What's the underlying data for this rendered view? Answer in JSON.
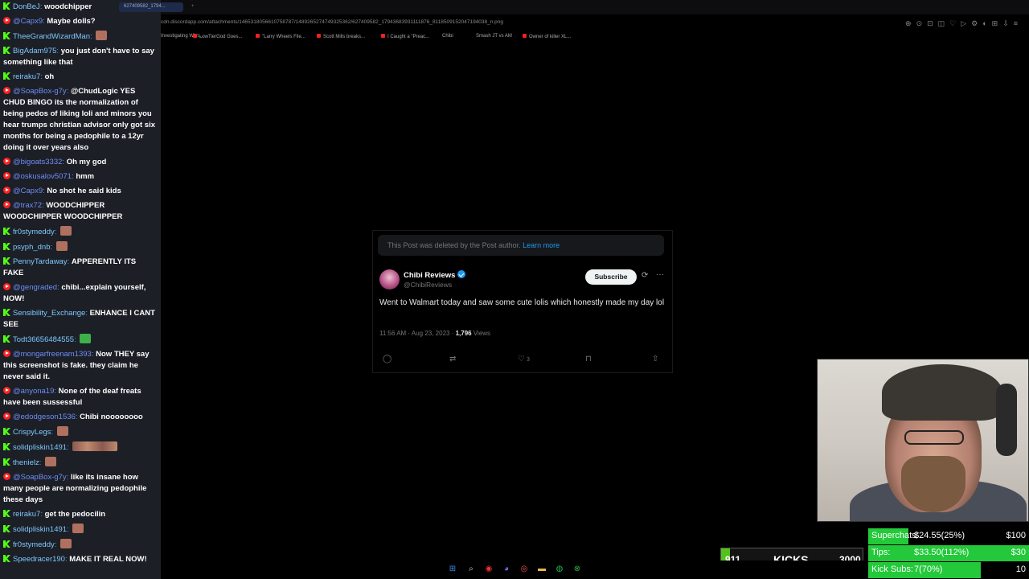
{
  "chat": {
    "messages": [
      {
        "platform": "kick",
        "user": "DonBeJ",
        "text": "woodchipper"
      },
      {
        "platform": "yt",
        "user": "@Capx9",
        "text": "Maybe dolls?"
      },
      {
        "platform": "kick",
        "user": "TheeGrandWizardMan",
        "text": "",
        "emote": "single"
      },
      {
        "platform": "kick",
        "user": "BigAdam975",
        "text": "you just don't have to say something like that"
      },
      {
        "platform": "kick",
        "user": "reiraku7",
        "text": "oh"
      },
      {
        "platform": "yt",
        "user": "@SoapBox-g7y",
        "text": "@ChudLogic YES CHUD BINGO its the normalization of being pedos of liking loli and minors you hear trumps christian advisor only got six months for being a pedophile to a 12yr doing it over years also"
      },
      {
        "platform": "yt",
        "user": "@bigoats3332",
        "text": "Oh my god"
      },
      {
        "platform": "yt",
        "user": "@oskusalov5071",
        "text": "hmm"
      },
      {
        "platform": "yt",
        "user": "@Capx9",
        "text": "No shot he said kids"
      },
      {
        "platform": "yt",
        "user": "@trax72",
        "text": "WOODCHIPPER WOODCHIPPER WOODCHIPPER"
      },
      {
        "platform": "kick",
        "user": "fr0stymeddy",
        "text": "",
        "emote": "single"
      },
      {
        "platform": "kick",
        "user": "psyph_dnb",
        "text": "",
        "emote": "single"
      },
      {
        "platform": "kick",
        "user": "PennyTardaway",
        "text": "APPERENTLY ITS FAKE"
      },
      {
        "platform": "yt",
        "user": "@gengraded",
        "text": "chibi...explain yourself, NOW!"
      },
      {
        "platform": "kick",
        "user": "Sensibility_Exchange",
        "text": "ENHANCE I CANT SEE"
      },
      {
        "platform": "kick",
        "user": "Todt36656484555",
        "text": "",
        "emote": "green"
      },
      {
        "platform": "yt",
        "user": "@mongarfreenam1393",
        "text": "Now THEY say this screenshot is fake. they claim he never said it."
      },
      {
        "platform": "yt",
        "user": "@anyona19",
        "text": "None of the deaf freats have been sussessful"
      },
      {
        "platform": "yt",
        "user": "@edodgeson1536",
        "text": "Chibi noooooooo"
      },
      {
        "platform": "kick",
        "user": "CrispyLegs",
        "text": "",
        "emote": "single"
      },
      {
        "platform": "kick",
        "user": "solidpliskin1491",
        "text": "",
        "emote": "wide"
      },
      {
        "platform": "kick",
        "user": "thenielz",
        "text": "",
        "emote": "single"
      },
      {
        "platform": "yt",
        "user": "@SoapBox-g7y",
        "text": "like its insane how many people are normalizing pedophile these days"
      },
      {
        "platform": "kick",
        "user": "reiraku7",
        "text": "get the pedocilin"
      },
      {
        "platform": "kick",
        "user": "solidpliskin1491",
        "text": "",
        "emote": "single"
      },
      {
        "platform": "kick",
        "user": "fr0stymeddy",
        "text": "",
        "emote": "single"
      },
      {
        "platform": "kick",
        "user": "Speedracer190",
        "text": "MAKE IT REAL NOW!"
      }
    ]
  },
  "browser": {
    "url": "cdn.discordapp.com/attachments/1465318056610758787/1489265274749325362/627409582_17943683931111876_8118509152047194038_n.png",
    "bookmarks": [
      "Investigating Wizt...",
      "LowTierGod Goes...",
      "\"Larry Wheels File...",
      "Scott Mills breaks...",
      "I Caught a \"Preac...",
      "Chibi",
      "Smash JT vs AM",
      "Owner of killer XL..."
    ]
  },
  "tweet": {
    "deleted_notice": "This Post was deleted by the Post author.",
    "learn_more": "Learn more",
    "name": "Chibi Reviews",
    "handle": "@ChibiReviews",
    "subscribe": "Subscribe",
    "text": "Went to Walmart today and saw some cute lolis which honestly made my day lol",
    "time": "11:56 AM · Aug 23, 2023 · ",
    "views_count": "1,796",
    "views_label": " Views",
    "likes": "3"
  },
  "kicks": {
    "count": "911",
    "label": "KICKS",
    "goal": "3000",
    "fill_fraction": 0.3
  },
  "goals": [
    {
      "label": "Superchats:",
      "value": "$24.55(25%)",
      "goal": "$100",
      "fill_fraction": 0.25
    },
    {
      "label": "Tips:",
      "value": "$33.50(112%)",
      "goal": "$30",
      "fill_fraction": 1.0
    },
    {
      "label": "Kick Subs:",
      "value": "7(70%)",
      "goal": "10",
      "fill_fraction": 0.7
    }
  ],
  "colors": {
    "kick_green": "#53fc18",
    "yt_red": "#ff2222",
    "twitter_blue": "#1d9bf0",
    "goal_green": "#23c93a"
  }
}
